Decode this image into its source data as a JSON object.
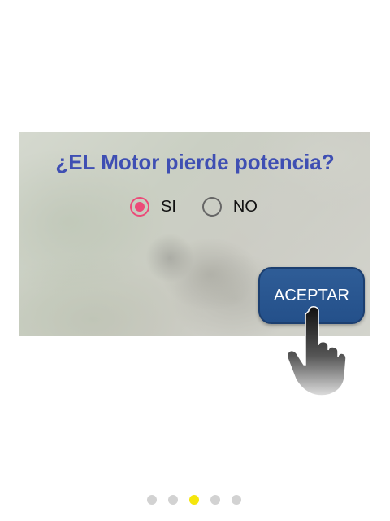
{
  "dialog": {
    "question": "¿EL Motor pierde potencia?",
    "options": [
      {
        "label": "SI",
        "selected": true
      },
      {
        "label": "NO",
        "selected": false
      }
    ],
    "accept_label": "ACEPTAR"
  },
  "pager": {
    "total": 5,
    "active_index": 2
  },
  "colors": {
    "question_text": "#3f4fb3",
    "radio_selected": "#ec4a78",
    "button_bg": "#24508a",
    "pager_active": "#f5e60c",
    "pager_inactive": "#d2d2d2"
  },
  "icons": {
    "tutorial_pointer": "pointing-hand-icon"
  }
}
